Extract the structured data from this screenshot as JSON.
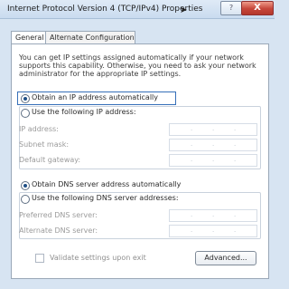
{
  "window": {
    "title": "Internet Protocol Version 4 (TCP/IPv4) Properties",
    "help": "?",
    "close": "X"
  },
  "tabs": [
    {
      "label": "General"
    },
    {
      "label": "Alternate Configuration"
    }
  ],
  "description": "You can get IP settings assigned automatically if your network supports this capability. Otherwise, you need to ask your network administrator for the appropriate IP settings.",
  "ip": {
    "auto_label": "Obtain an IP address automatically",
    "manual_label": "Use the following IP address:",
    "fields": [
      {
        "label": "IP address:"
      },
      {
        "label": "Subnet mask:"
      },
      {
        "label": "Default gateway:"
      }
    ]
  },
  "dns": {
    "auto_label": "Obtain DNS server address automatically",
    "manual_label": "Use the following DNS server addresses:",
    "fields": [
      {
        "label": "Preferred DNS server:"
      },
      {
        "label": "Alternate DNS server:"
      }
    ]
  },
  "validate_label": "Validate settings upon exit",
  "advanced_button": "Advanced..."
}
